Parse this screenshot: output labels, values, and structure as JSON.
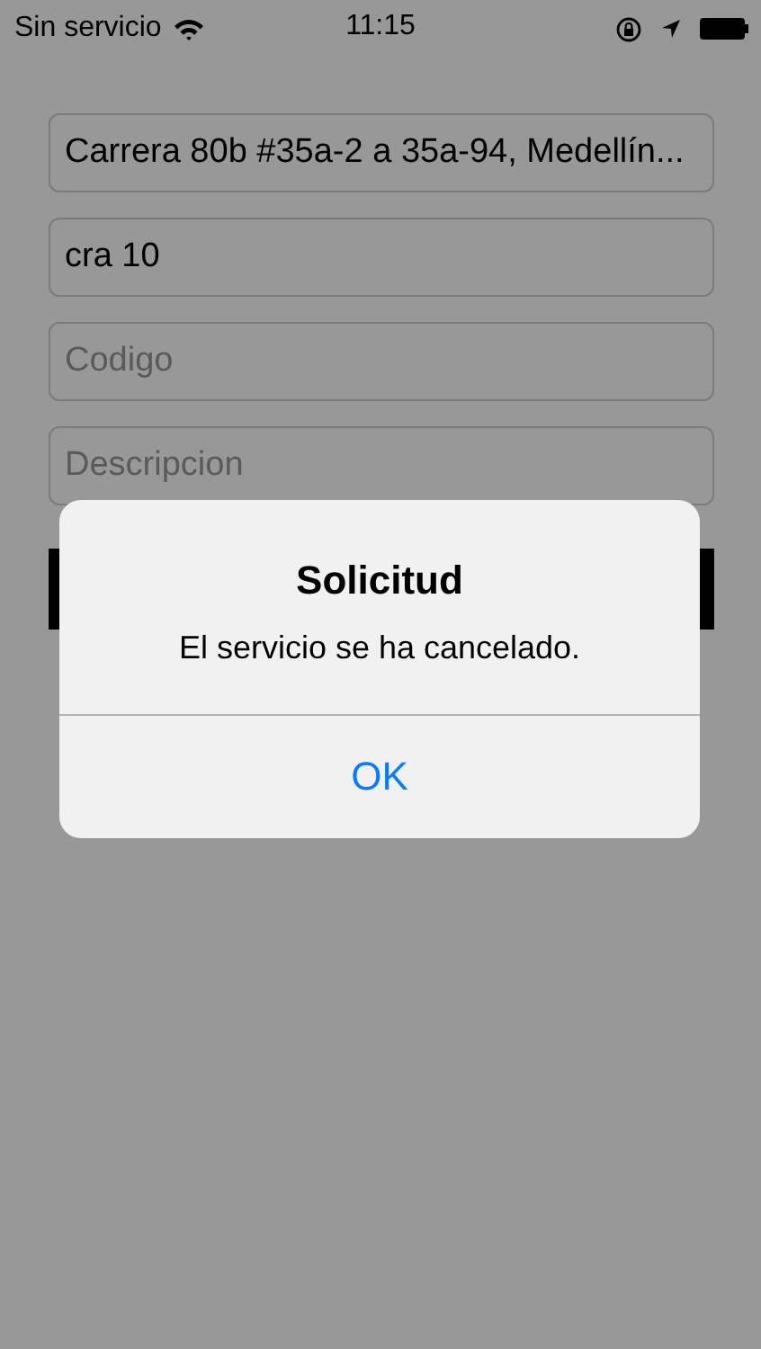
{
  "status_bar": {
    "carrier": "Sin servicio",
    "time": "11:15"
  },
  "form": {
    "fields": [
      {
        "value": "Carrera 80b #35a-2 a 35a-94, Medellín..."
      },
      {
        "value": "cra 10"
      },
      {
        "placeholder": "Codigo"
      },
      {
        "placeholder": "Descripcion"
      }
    ]
  },
  "alert": {
    "title": "Solicitud",
    "message": "El servicio se ha cancelado.",
    "buttons": [
      "OK"
    ]
  }
}
